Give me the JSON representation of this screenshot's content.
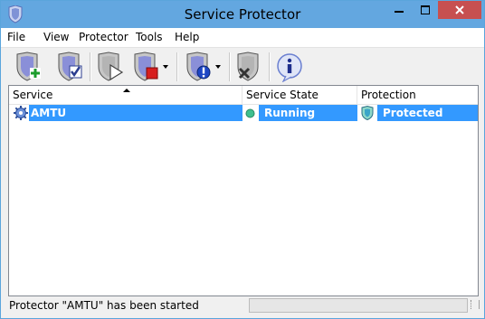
{
  "window": {
    "title": "Service Protector"
  },
  "menu": [
    "File",
    "View",
    "Protector",
    "Tools",
    "Help"
  ],
  "toolbar": [
    {
      "icon": "add-protector-icon"
    },
    {
      "icon": "check-protector-icon"
    },
    {
      "icon": "start-protector-icon"
    },
    {
      "icon": "stop-protector-icon"
    },
    {
      "icon": "alert-protector-icon"
    },
    {
      "icon": "delete-protector-icon"
    },
    {
      "icon": "info-icon"
    }
  ],
  "list": {
    "columns": [
      "Service",
      "Service State",
      "Protection"
    ],
    "rows": [
      {
        "service": "AMTU",
        "state": "Running",
        "protection": "Protected",
        "selected": true
      }
    ]
  },
  "status": {
    "text": "Protector \"AMTU\" has been started",
    "progress": 0
  },
  "colors": {
    "titlebar": "#63a7e0",
    "selection": "#3399ff",
    "close": "#c75050",
    "running": "#3fbf8f"
  }
}
